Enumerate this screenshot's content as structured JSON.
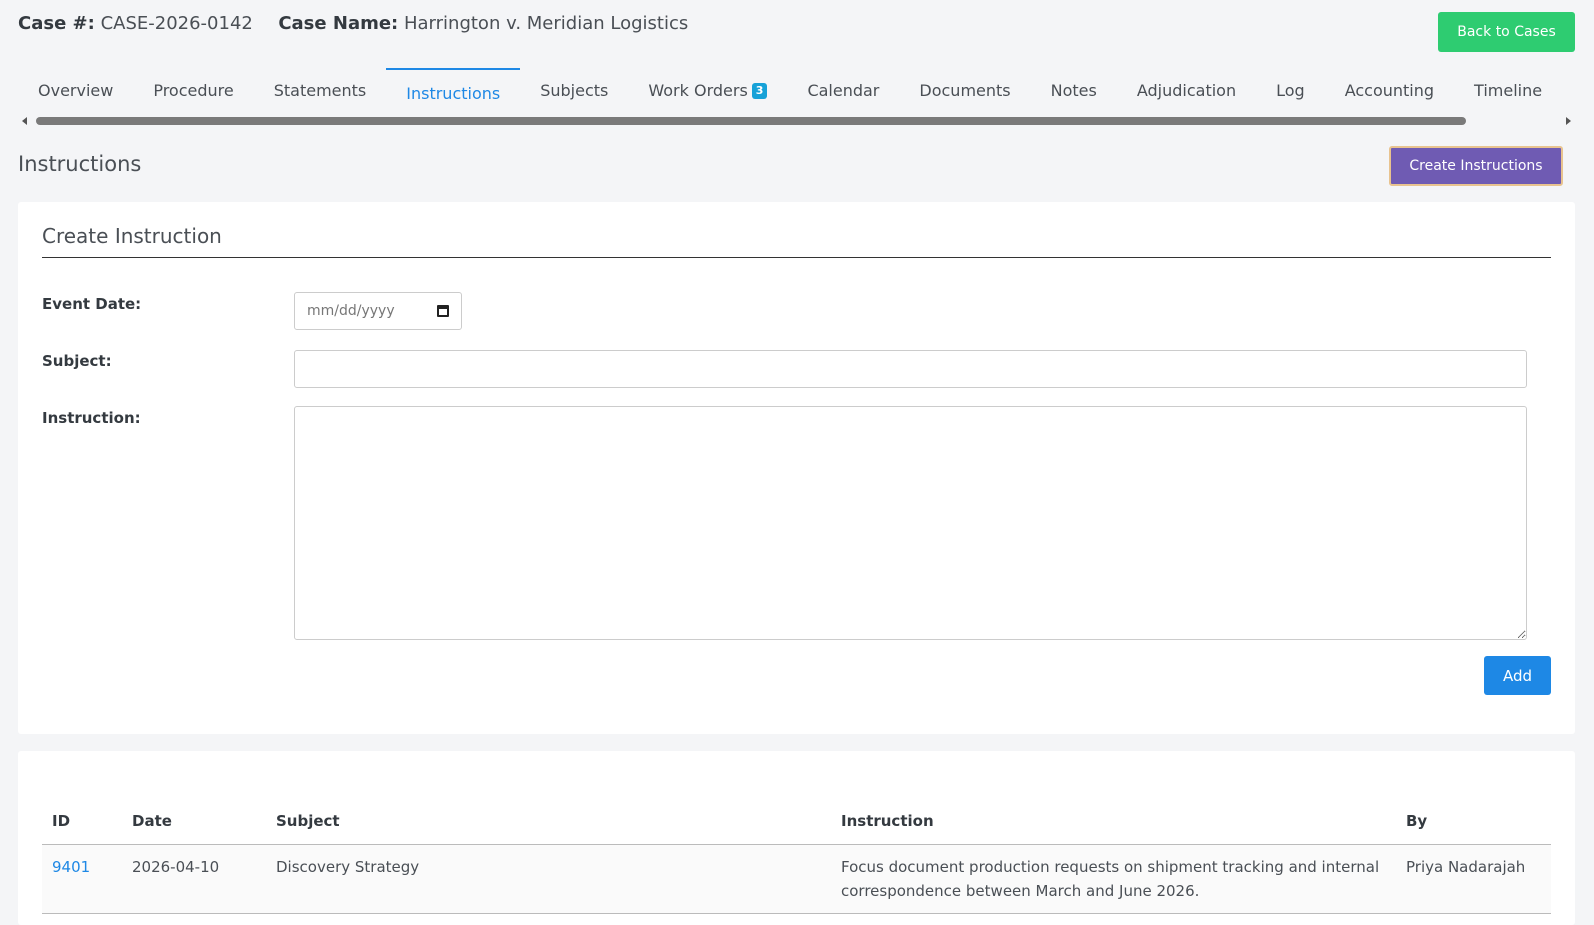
{
  "header": {
    "case_number_label": "Case #:",
    "case_number": "CASE-2026-0142",
    "case_name_label": "Case Name:",
    "case_name": "Harrington v. Meridian Logistics",
    "back_button": "Back to Cases"
  },
  "tabs": [
    {
      "label": "Overview",
      "active": false
    },
    {
      "label": "Procedure",
      "active": false
    },
    {
      "label": "Statements",
      "active": false
    },
    {
      "label": "Instructions",
      "active": true
    },
    {
      "label": "Subjects",
      "active": false
    },
    {
      "label": "Work Orders",
      "badge": "3",
      "active": false
    },
    {
      "label": "Calendar",
      "active": false
    },
    {
      "label": "Documents",
      "active": false
    },
    {
      "label": "Notes",
      "active": false
    },
    {
      "label": "Adjudication",
      "active": false
    },
    {
      "label": "Log",
      "active": false
    },
    {
      "label": "Accounting",
      "active": false
    },
    {
      "label": "Timeline",
      "active": false
    }
  ],
  "section": {
    "title": "Instructions",
    "create_button": "Create Instructions"
  },
  "form": {
    "title": "Create Instruction",
    "event_date_label": "Event Date:",
    "event_date_placeholder": "mm/dd/yyyy",
    "subject_label": "Subject:",
    "subject_value": "",
    "instruction_label": "Instruction:",
    "instruction_value": "",
    "add_button": "Add"
  },
  "table": {
    "columns": [
      "ID",
      "Date",
      "Subject",
      "Instruction",
      "By"
    ],
    "rows": [
      {
        "id": "9401",
        "date": "2026-04-10",
        "subject": "Discovery Strategy",
        "instruction": "Focus document production requests on shipment tracking and internal correspondence between March and June 2026.",
        "by": "Priya Nadarajah"
      }
    ]
  },
  "colors": {
    "accent_blue": "#1e88e5",
    "back_green": "#2ecc71",
    "create_purple": "#6f5bb3",
    "badge_blue": "#17a2d8"
  }
}
